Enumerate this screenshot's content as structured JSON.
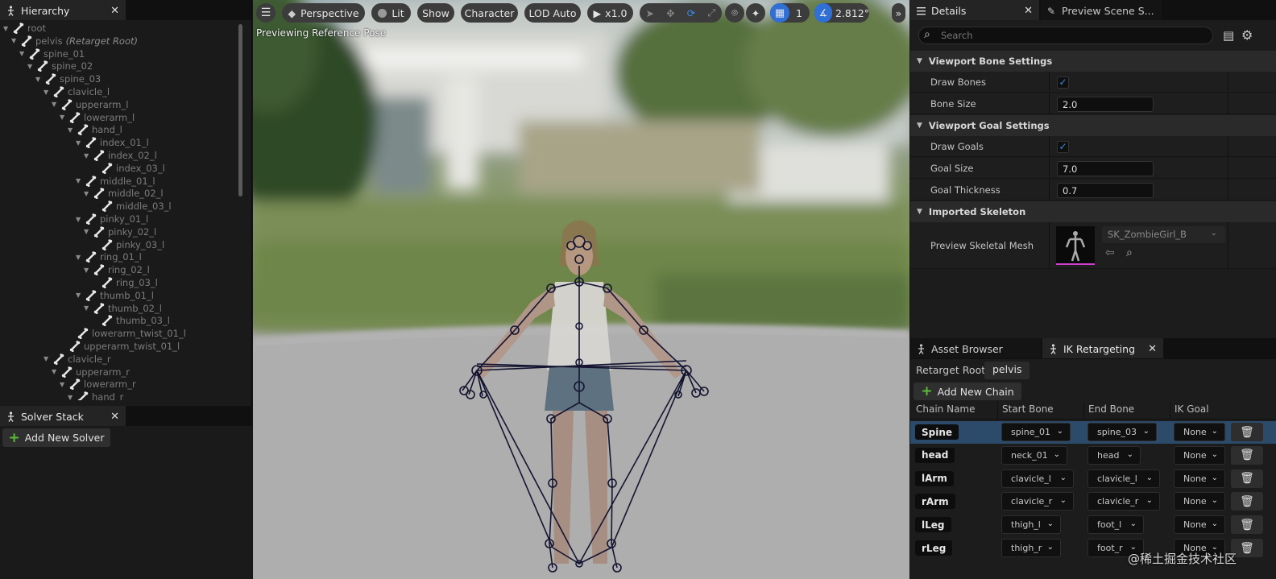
{
  "hierarchy": {
    "tab_label": "Hierarchy",
    "nodes": [
      {
        "label": "root",
        "note": ""
      },
      {
        "label": "pelvis",
        "note": "(Retarget Root)"
      },
      {
        "label": "spine_01",
        "note": ""
      },
      {
        "label": "spine_02",
        "note": ""
      },
      {
        "label": "spine_03",
        "note": ""
      },
      {
        "label": "clavicle_l",
        "note": ""
      },
      {
        "label": "upperarm_l",
        "note": ""
      },
      {
        "label": "lowerarm_l",
        "note": ""
      },
      {
        "label": "hand_l",
        "note": ""
      },
      {
        "label": "index_01_l",
        "note": ""
      },
      {
        "label": "index_02_l",
        "note": ""
      },
      {
        "label": "index_03_l",
        "note": ""
      },
      {
        "label": "middle_01_l",
        "note": ""
      },
      {
        "label": "middle_02_l",
        "note": ""
      },
      {
        "label": "middle_03_l",
        "note": ""
      },
      {
        "label": "pinky_01_l",
        "note": ""
      },
      {
        "label": "pinky_02_l",
        "note": ""
      },
      {
        "label": "pinky_03_l",
        "note": ""
      },
      {
        "label": "ring_01_l",
        "note": ""
      },
      {
        "label": "ring_02_l",
        "note": ""
      },
      {
        "label": "ring_03_l",
        "note": ""
      },
      {
        "label": "thumb_01_l",
        "note": ""
      },
      {
        "label": "thumb_02_l",
        "note": ""
      },
      {
        "label": "thumb_03_l",
        "note": ""
      },
      {
        "label": "lowerarm_twist_01_l",
        "note": ""
      },
      {
        "label": "upperarm_twist_01_l",
        "note": ""
      },
      {
        "label": "clavicle_r",
        "note": ""
      },
      {
        "label": "upperarm_r",
        "note": ""
      },
      {
        "label": "lowerarm_r",
        "note": ""
      },
      {
        "label": "hand_r",
        "note": ""
      }
    ]
  },
  "solver_stack": {
    "tab_label": "Solver Stack",
    "add_button": "Add New Solver"
  },
  "viewport": {
    "perspective": "Perspective",
    "lit": "Lit",
    "show": "Show",
    "character": "Character",
    "lod": "LOD Auto",
    "play_speed": "x1.0",
    "grid_value": "1",
    "angle_value": "2.812°",
    "status": "Previewing Reference Pose"
  },
  "details": {
    "tab_label": "Details",
    "preview_tab_label": "Preview Scene S...",
    "search_placeholder": "Search",
    "sections": {
      "bone": "Viewport Bone Settings",
      "goal": "Viewport Goal Settings",
      "skeleton": "Imported Skeleton"
    },
    "props": {
      "draw_bones": "Draw Bones",
      "bone_size": "Bone Size",
      "bone_size_value": "2.0",
      "draw_goals": "Draw Goals",
      "goal_size": "Goal Size",
      "goal_size_value": "7.0",
      "goal_thickness": "Goal Thickness",
      "goal_thickness_value": "0.7",
      "preview_mesh": "Preview Skeletal Mesh",
      "preview_mesh_value": "SK_ZombieGirl_B"
    }
  },
  "ik": {
    "asset_browser_tab": "Asset Browser",
    "ik_tab": "IK Retargeting",
    "retarget_root_label": "Retarget Root:",
    "retarget_root_value": "pelvis",
    "add_chain": "Add New Chain",
    "columns": [
      "Chain Name",
      "Start Bone",
      "End Bone",
      "IK Goal"
    ],
    "rows": [
      {
        "name": "Spine",
        "start": "spine_01",
        "end": "spine_03",
        "goal": "None"
      },
      {
        "name": "head",
        "start": "neck_01",
        "end": "head",
        "goal": "None"
      },
      {
        "name": "lArm",
        "start": "clavicle_l",
        "end": "clavicle_l",
        "goal": "None"
      },
      {
        "name": "rArm",
        "start": "clavicle_r",
        "end": "clavicle_r",
        "goal": "None"
      },
      {
        "name": "lLeg",
        "start": "thigh_l",
        "end": "foot_l",
        "goal": "None"
      },
      {
        "name": "rLeg",
        "start": "thigh_r",
        "end": "foot_r",
        "goal": "None"
      }
    ]
  },
  "watermark": "@稀土掘金技术社区"
}
